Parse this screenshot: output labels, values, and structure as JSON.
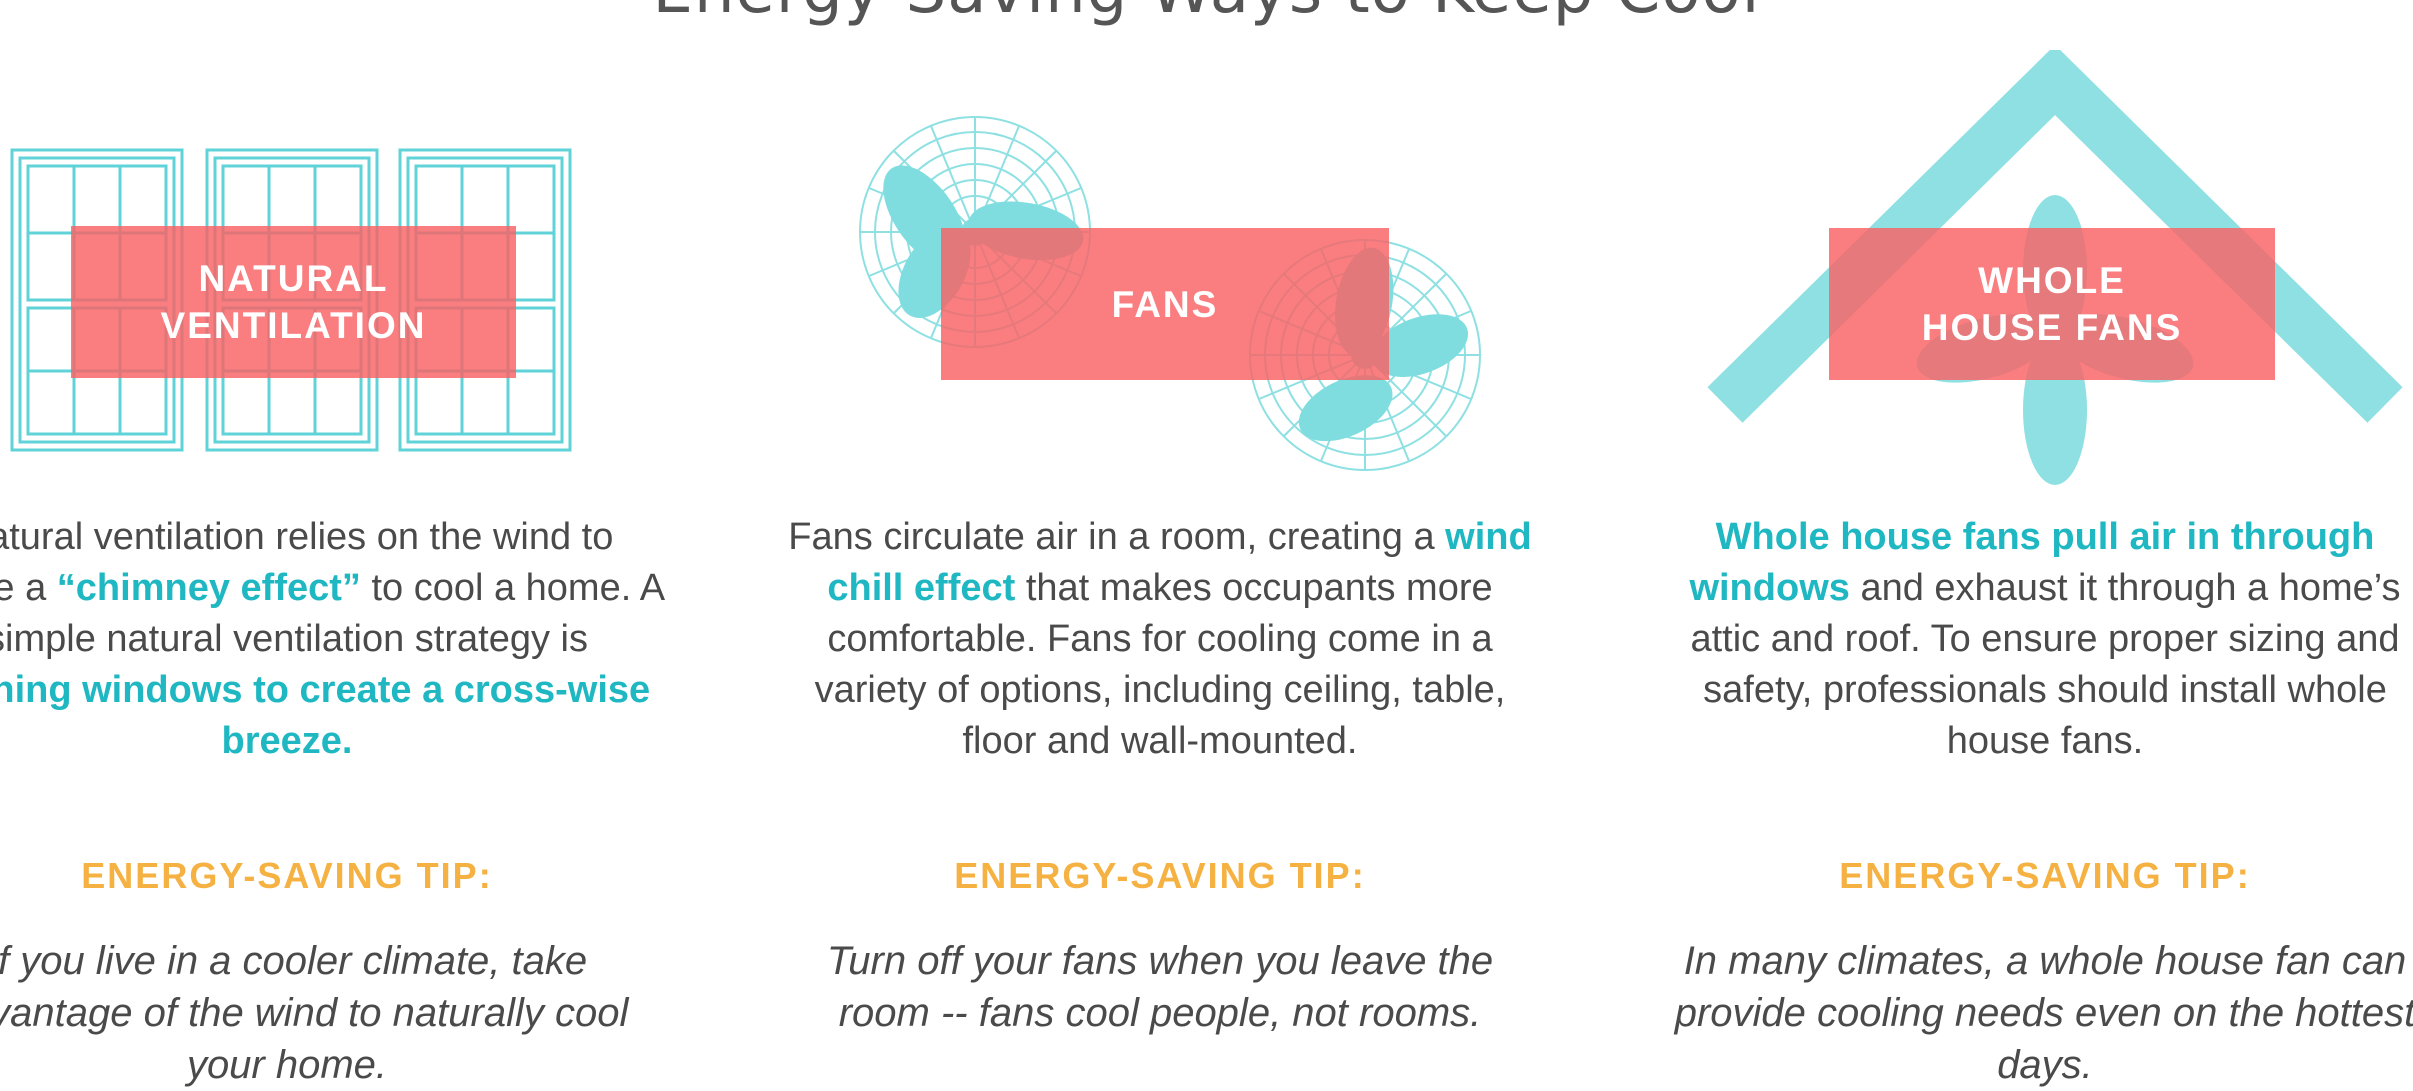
{
  "header": {
    "title": "Energy-Saving Ways to Keep Cool"
  },
  "colors": {
    "teal": "#1fb8c2",
    "teal_light": "#8ee0e2",
    "coral": "#f96164",
    "orange": "#f5b141",
    "text": "#4a4a4a"
  },
  "columns": [
    {
      "label_line1": "NATURAL",
      "label_line2": "VENTILATION",
      "icon": "windows-icon",
      "desc_p1": "Natural ventilation relies on the wind to create a ",
      "desc_h1": "“chimney effect”",
      "desc_p2": " to cool a home. A simple natural ventilation strategy is ",
      "desc_h2": "opening windows to create a cross-wise breeze.",
      "tip_heading": "ENERGY-SAVING TIP:",
      "tip_text": "If you live in a cooler climate, take advantage of the wind to naturally cool your home."
    },
    {
      "label_line1": "FANS",
      "icon": "fan-icon",
      "desc_p1": "Fans circulate air in a room, creating a ",
      "desc_h1": "wind chill effect",
      "desc_p2": " that makes occupants more comfortable. Fans for cooling come in a variety of options, including ceiling, table, floor and wall-mounted.",
      "tip_heading": "ENERGY-SAVING TIP:",
      "tip_text": "Turn off your fans when you leave the room -- fans cool people, not rooms."
    },
    {
      "label_line1": "WHOLE",
      "label_line2": "HOUSE FANS",
      "icon": "house-fan-icon",
      "desc_h1": "Whole house fans pull air in through windows",
      "desc_p2": " and exhaust it through a home’s attic and roof. To ensure proper sizing and safety, professionals should install whole house fans.",
      "tip_heading": "ENERGY-SAVING TIP:",
      "tip_text": "In many climates, a whole house fan can provide cooling needs even on the hottest days."
    }
  ]
}
